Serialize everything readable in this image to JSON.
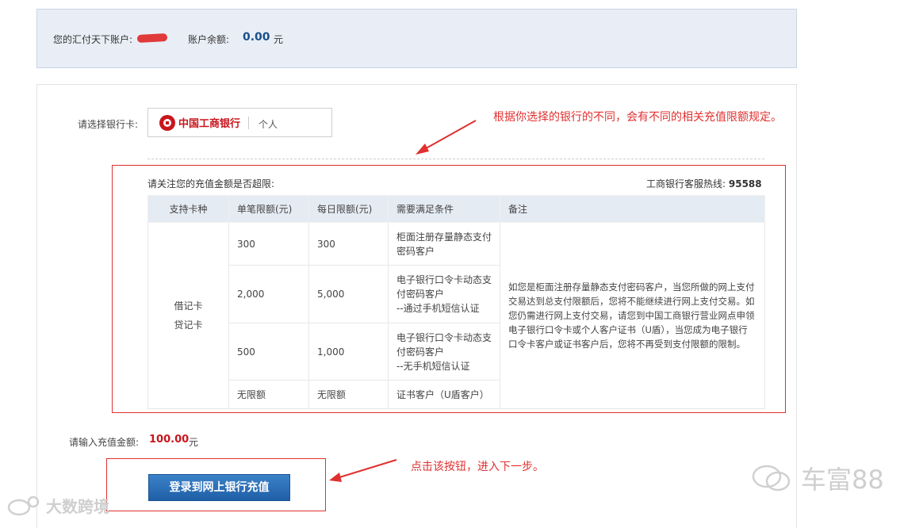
{
  "account": {
    "label": "您的汇付天下账户:",
    "balance_label": "账户余额:",
    "balance_value": "0.00",
    "balance_unit": "元"
  },
  "bank_select": {
    "label": "请选择银行卡:",
    "bank_name": "中国工商银行",
    "card_owner_type": "个人"
  },
  "annotations": {
    "bank_note": "根据你选择的银行的不同，会有不同的相关充值限额规定。",
    "button_note": "点击该按钮，进入下一步。"
  },
  "limits": {
    "title": "请关注您的充值金额是否超限:",
    "hotline_label": "工商银行客服热线:",
    "hotline_number": "95588",
    "headers": [
      "支持卡种",
      "单笔限额(元)",
      "每日限额(元)",
      "需要满足条件",
      "备注"
    ],
    "card_types": [
      "借记卡",
      "贷记卡"
    ],
    "rows": [
      {
        "single": "300",
        "daily": "300",
        "condition": "柜面注册存量静态支付密码客户"
      },
      {
        "single": "2,000",
        "daily": "5,000",
        "condition": "电子银行口令卡动态支付密码客户\n--通过手机短信认证"
      },
      {
        "single": "500",
        "daily": "1,000",
        "condition": "电子银行口令卡动态支付密码客户\n--无手机短信认证"
      },
      {
        "single": "无限额",
        "daily": "无限额",
        "condition": "证书客户（U盾客户）"
      }
    ],
    "remark": "如您是柜面注册存量静态支付密码客户，当您所做的网上支付交易达到总支付限额后，您将不能继续进行网上支付交易。如您仍需进行网上支付交易，请您到中国工商银行营业网点申领电子银行口令卡或个人客户证书（U盾），当您成为电子银行口令卡客户或证书客户后，您将不再受到支付限额的限制。"
  },
  "amount": {
    "label": "请输入充值金额:",
    "value": "100.00",
    "unit": "元"
  },
  "login_button": {
    "label": "登录到网上银行充值"
  },
  "watermarks": {
    "right": "车富88",
    "left": "大数跨境"
  },
  "colors": {
    "annotation": "#e03030",
    "bank_red": "#c8161d",
    "button_blue": "#1f5fa6",
    "panel_bg": "#e9eef6"
  }
}
